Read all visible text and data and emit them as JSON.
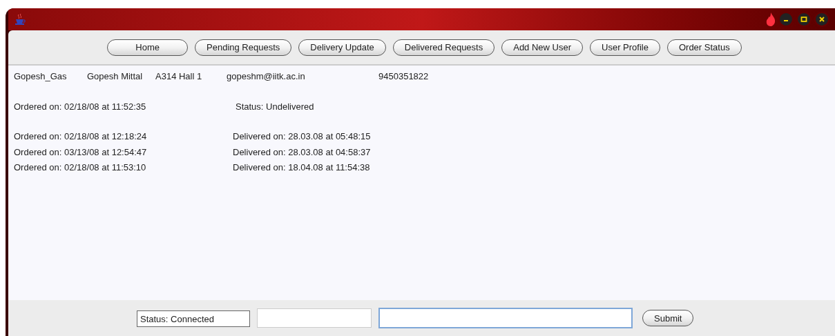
{
  "nav_buttons": [
    {
      "label": "Home"
    },
    {
      "label": "Pending Requests"
    },
    {
      "label": "Delivery Update"
    },
    {
      "label": "Delivered Requests"
    },
    {
      "label": "Add New User"
    },
    {
      "label": "User Profile"
    },
    {
      "label": "Order Status"
    }
  ],
  "profile": {
    "username": "Gopesh_Gas",
    "name": "Gopesh Mittal",
    "address": "A314 Hall 1",
    "email": "gopeshm@iitk.ac.in",
    "phone": "9450351822"
  },
  "pending_orders": [
    {
      "ordered": "Ordered on: 02/18/08 at 11:52:35",
      "status": "Status: Undelivered"
    }
  ],
  "delivered_orders": [
    {
      "ordered": "Ordered on: 02/18/08 at 12:18:24",
      "delivered": "Delivered on: 28.03.08 at 05:48:15"
    },
    {
      "ordered": "Ordered on: 03/13/08 at 12:54:47",
      "delivered": "Delivered on: 28.03.08 at 04:58:37"
    },
    {
      "ordered": "Ordered on: 02/18/08 at 11:53:10",
      "delivered": "Delivered on: 18.04.08 at 11:54:38"
    }
  ],
  "bottom_bar": {
    "fields": [
      {
        "kind": "status",
        "value": "Status: Connected",
        "focused": false
      },
      {
        "kind": "blank",
        "focused": false
      },
      {
        "kind": "input",
        "focused": true
      }
    ],
    "submit": "Submit"
  }
}
